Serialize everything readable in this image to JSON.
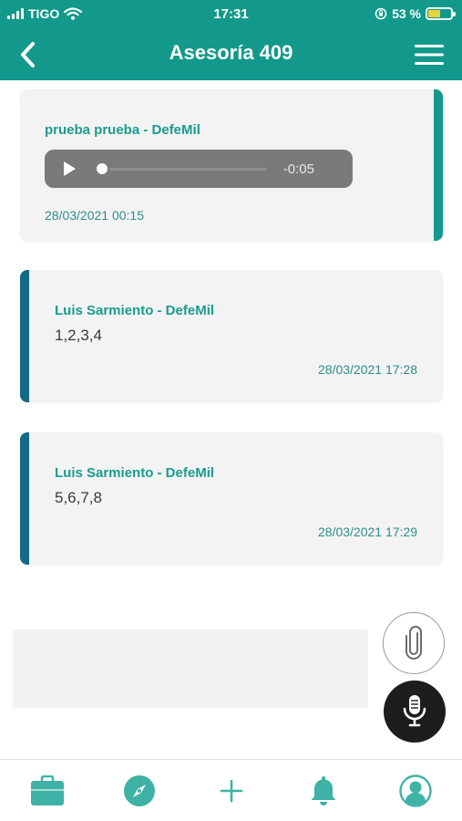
{
  "status_bar": {
    "carrier": "TIGO",
    "time": "17:31",
    "battery_percent": "53 %",
    "battery_level": 0.53
  },
  "header": {
    "title": "Asesoría 409",
    "back_icon": "chevron-left-icon",
    "menu_icon": "hamburger-icon"
  },
  "messages": [
    {
      "type": "audio",
      "sender": "prueba prueba - DefeMil",
      "audio": {
        "remaining": "-0:05",
        "progress": 0
      },
      "timestamp": "28/03/2021 00:15"
    },
    {
      "type": "text",
      "sender": "Luis Sarmiento - DefeMil",
      "text": "1,2,3,4",
      "timestamp": "28/03/2021 17:28"
    },
    {
      "type": "text",
      "sender": "Luis Sarmiento - DefeMil",
      "text": "5,6,7,8",
      "timestamp": "28/03/2021 17:29"
    }
  ],
  "compose": {
    "placeholder": ""
  },
  "actions": {
    "attach_icon": "paperclip-icon",
    "mic_icon": "microphone-icon"
  },
  "tab_bar": {
    "items": [
      "briefcase-icon",
      "compass-icon",
      "plus-icon",
      "bell-icon",
      "profile-icon"
    ]
  },
  "colors": {
    "primary": "#12998b",
    "accent_dark": "#136a84",
    "card_bg": "#f3f3f3",
    "text": "#3a3a3a"
  }
}
